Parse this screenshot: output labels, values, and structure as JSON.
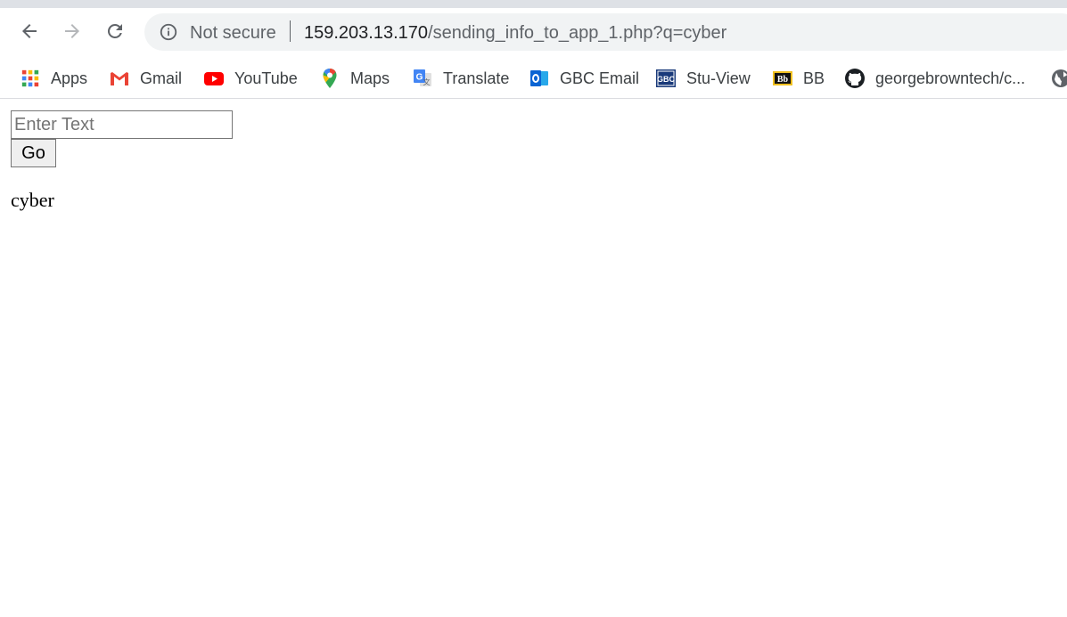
{
  "browser": {
    "security_label": "Not secure",
    "url_host": "159.203.13.170",
    "url_path": "/sending_info_to_app_1.php?q=cyber"
  },
  "bookmarks": [
    {
      "label": "Apps",
      "icon": "apps-grid-icon"
    },
    {
      "label": "Gmail",
      "icon": "gmail-icon"
    },
    {
      "label": "YouTube",
      "icon": "youtube-icon"
    },
    {
      "label": "Maps",
      "icon": "maps-icon"
    },
    {
      "label": "Translate",
      "icon": "translate-icon"
    },
    {
      "label": "GBC Email",
      "icon": "outlook-icon"
    },
    {
      "label": "Stu-View",
      "icon": "gbc-icon"
    },
    {
      "label": "BB",
      "icon": "blackboard-icon"
    },
    {
      "label": "georgebrowntech/c...",
      "icon": "github-icon"
    }
  ],
  "page": {
    "input_placeholder": "Enter Text",
    "go_label": "Go",
    "result_text": "cyber"
  },
  "colors": {
    "accent_red": "#ea4335",
    "youtube_red": "#ff0000",
    "outlook_blue": "#0a64d3",
    "gbc_blue": "#1a3a7a"
  }
}
